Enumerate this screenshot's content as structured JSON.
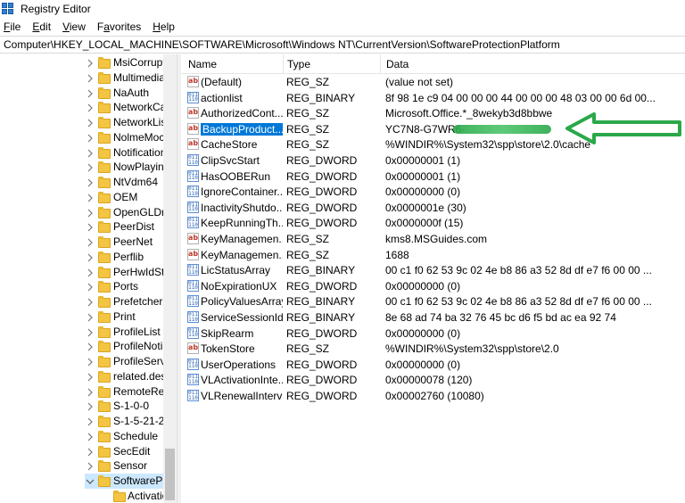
{
  "window": {
    "title": "Registry Editor"
  },
  "menu": [
    "File",
    "Edit",
    "View",
    "Favorites",
    "Help"
  ],
  "menu_accel": [
    "F",
    "E",
    "V",
    "a",
    "H"
  ],
  "address": "Computer\\HKEY_LOCAL_MACHINE\\SOFTWARE\\Microsoft\\Windows NT\\CurrentVersion\\SoftwareProtectionPlatform",
  "tree": {
    "items": [
      {
        "label": "MsiCorrupt",
        "expanded": false
      },
      {
        "label": "Multimedia",
        "expanded": false
      },
      {
        "label": "NaAuth",
        "expanded": false
      },
      {
        "label": "NetworkCa",
        "expanded": false
      },
      {
        "label": "NetworkLis",
        "expanded": false
      },
      {
        "label": "NolmeMoc",
        "expanded": false
      },
      {
        "label": "Notification",
        "expanded": false
      },
      {
        "label": "NowPlaying",
        "expanded": false
      },
      {
        "label": "NtVdm64",
        "expanded": false
      },
      {
        "label": "OEM",
        "expanded": false
      },
      {
        "label": "OpenGLDri",
        "expanded": false
      },
      {
        "label": "PeerDist",
        "expanded": false
      },
      {
        "label": "PeerNet",
        "expanded": false
      },
      {
        "label": "Perflib",
        "expanded": false
      },
      {
        "label": "PerHwIdSto",
        "expanded": false
      },
      {
        "label": "Ports",
        "expanded": false
      },
      {
        "label": "Prefetcher",
        "expanded": false
      },
      {
        "label": "Print",
        "expanded": false
      },
      {
        "label": "ProfileList",
        "expanded": false
      },
      {
        "label": "ProfileNoti",
        "expanded": false
      },
      {
        "label": "ProfileServi",
        "expanded": false
      },
      {
        "label": "related.desc",
        "expanded": false
      },
      {
        "label": "RemoteReg",
        "expanded": false
      },
      {
        "label": "S-1-0-0",
        "expanded": false
      },
      {
        "label": "S-1-5-21-22",
        "expanded": false
      },
      {
        "label": "Schedule",
        "expanded": false
      },
      {
        "label": "SecEdit",
        "expanded": false
      },
      {
        "label": "Sensor",
        "expanded": false
      },
      {
        "label": "SoftwarePr",
        "expanded": true,
        "selected": true
      },
      {
        "label": "Activatio",
        "child": true
      }
    ]
  },
  "columns": {
    "name": "Name",
    "type": "Type",
    "data": "Data"
  },
  "values": [
    {
      "name": "(Default)",
      "type": "REG_SZ",
      "data": "(value not set)",
      "kind": "sz"
    },
    {
      "name": "actionlist",
      "type": "REG_BINARY",
      "data": "8f 98 1e c9 04 00 00 00 44 00 00 00 48 03 00 00 6d 00...",
      "kind": "bin"
    },
    {
      "name": "AuthorizedCont...",
      "type": "REG_SZ",
      "data": "Microsoft.Office.*_8wekyb3d8bbwe",
      "kind": "sz"
    },
    {
      "name": "BackupProduct...",
      "type": "REG_SZ",
      "data": "YC7N8-G7WR6-",
      "kind": "sz",
      "selected": true
    },
    {
      "name": "CacheStore",
      "type": "REG_SZ",
      "data": "%WINDIR%\\System32\\spp\\store\\2.0\\cache",
      "kind": "sz"
    },
    {
      "name": "ClipSvcStart",
      "type": "REG_DWORD",
      "data": "0x00000001 (1)",
      "kind": "bin"
    },
    {
      "name": "HasOOBERun",
      "type": "REG_DWORD",
      "data": "0x00000001 (1)",
      "kind": "bin"
    },
    {
      "name": "IgnoreContainer...",
      "type": "REG_DWORD",
      "data": "0x00000000 (0)",
      "kind": "bin"
    },
    {
      "name": "InactivityShutdo...",
      "type": "REG_DWORD",
      "data": "0x0000001e (30)",
      "kind": "bin"
    },
    {
      "name": "KeepRunningTh...",
      "type": "REG_DWORD",
      "data": "0x0000000f (15)",
      "kind": "bin"
    },
    {
      "name": "KeyManagemen...",
      "type": "REG_SZ",
      "data": "kms8.MSGuides.com",
      "kind": "sz"
    },
    {
      "name": "KeyManagemen...",
      "type": "REG_SZ",
      "data": "1688",
      "kind": "sz"
    },
    {
      "name": "LicStatusArray",
      "type": "REG_BINARY",
      "data": "00 c1 f0 62 53 9c 02 4e b8 86 a3 52 8d df e7 f6 00 00 ...",
      "kind": "bin"
    },
    {
      "name": "NoExpirationUX",
      "type": "REG_DWORD",
      "data": "0x00000000 (0)",
      "kind": "bin"
    },
    {
      "name": "PolicyValuesArray",
      "type": "REG_BINARY",
      "data": "00 c1 f0 62 53 9c 02 4e b8 86 a3 52 8d df e7 f6 00 00 ...",
      "kind": "bin"
    },
    {
      "name": "ServiceSessionId",
      "type": "REG_BINARY",
      "data": "8e 68 ad 74 ba 32 76 45 bc d6 f5 bd ac ea 92 74",
      "kind": "bin"
    },
    {
      "name": "SkipRearm",
      "type": "REG_DWORD",
      "data": "0x00000000 (0)",
      "kind": "bin"
    },
    {
      "name": "TokenStore",
      "type": "REG_SZ",
      "data": "%WINDIR%\\System32\\spp\\store\\2.0",
      "kind": "sz"
    },
    {
      "name": "UserOperations",
      "type": "REG_DWORD",
      "data": "0x00000000 (0)",
      "kind": "bin"
    },
    {
      "name": "VLActivationInte...",
      "type": "REG_DWORD",
      "data": "0x00000078 (120)",
      "kind": "bin"
    },
    {
      "name": "VLRenewalInterval",
      "type": "REG_DWORD",
      "data": "0x00002760 (10080)",
      "kind": "bin"
    }
  ],
  "colors": {
    "selection": "#0078d7",
    "arrow": "#2aa84a",
    "folder": "#f4c542"
  }
}
